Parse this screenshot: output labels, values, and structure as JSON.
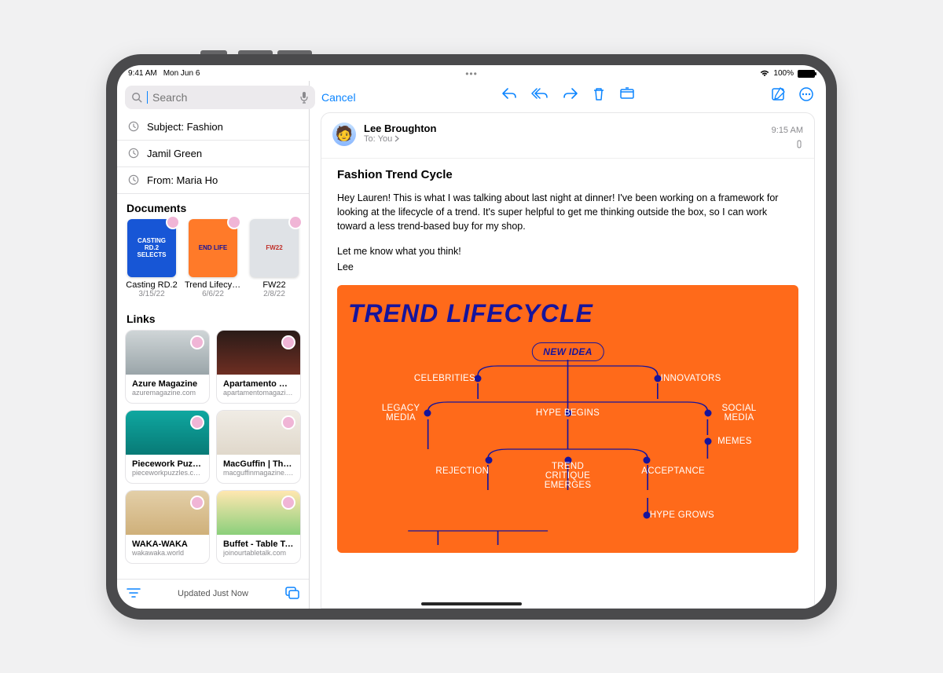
{
  "status": {
    "time": "9:41 AM",
    "date": "Mon Jun 6",
    "battery": "100%"
  },
  "search": {
    "placeholder": "Search",
    "cancel": "Cancel"
  },
  "suggestions": [
    {
      "text": "Subject: Fashion"
    },
    {
      "text": "Jamil Green"
    },
    {
      "text": "From: Maria Ho"
    }
  ],
  "documents_header": "Documents",
  "documents": [
    {
      "name": "Casting RD.2",
      "date": "3/15/22",
      "thumb_bg": "#1756d6",
      "thumb_text": "CASTING RD.2 SELECTS"
    },
    {
      "name": "Trend Lifecycle",
      "date": "6/6/22",
      "thumb_bg": "#ff7a29",
      "thumb_text": "END LIFE"
    },
    {
      "name": "FW22",
      "date": "2/8/22",
      "thumb_bg": "#e8e3dc",
      "thumb_text": "FW22"
    }
  ],
  "links_header": "Links",
  "links": [
    {
      "title": "Azure Magazine",
      "url": "azuremagazine.com",
      "bg": "linear-gradient(#cfd5d7,#9aa5a9)"
    },
    {
      "title": "Apartamento Maga...",
      "url": "apartamentomagazine.c...",
      "bg": "linear-gradient(#2a1b18,#6e2e22)"
    },
    {
      "title": "Piecework Puzzles",
      "url": "pieceworkpuzzles.com",
      "bg": "linear-gradient(#0fa7a0,#087a76)"
    },
    {
      "title": "MacGuffin | The Lif...",
      "url": "macguffinmagazine.com",
      "bg": "linear-gradient(#f0ece5,#e0d8cb)"
    },
    {
      "title": "WAKA-WAKA",
      "url": "wakawaka.world",
      "bg": "linear-gradient(#e3cfa8,#cfb07a)"
    },
    {
      "title": "Buffet - Table Talk",
      "url": "joinourtabletalk.com",
      "bg": "linear-gradient(#ffe7b0,#ffd080)"
    }
  ],
  "sidebar_footer": {
    "status": "Updated Just Now"
  },
  "message": {
    "from": "Lee Broughton",
    "to_label": "To:",
    "to": "You",
    "time": "9:15 AM",
    "subject": "Fashion Trend Cycle",
    "body1": "Hey Lauren! This is what I was talking about last night at dinner! I've been working on a framework for looking at the lifecycle of a trend. It's super helpful to get me thinking outside the box, so I can work toward a less trend-based buy for my shop.",
    "body2": "Let me know what you think!",
    "signoff": "Lee",
    "attachment": {
      "title": "TREND LIFECYCLE",
      "nodes": {
        "newidea": "NEW IDEA",
        "celebrities": "CELEBRITIES",
        "innovators": "INNOVATORS",
        "legacy": "LEGACY MEDIA",
        "hype": "HYPE BEGINS",
        "social": "SOCIAL MEDIA",
        "memes": "MEMES",
        "rejection": "REJECTION",
        "critique": "TREND CRITIQUE EMERGES",
        "acceptance": "ACCEPTANCE",
        "grows": "HYPE GROWS"
      }
    }
  }
}
